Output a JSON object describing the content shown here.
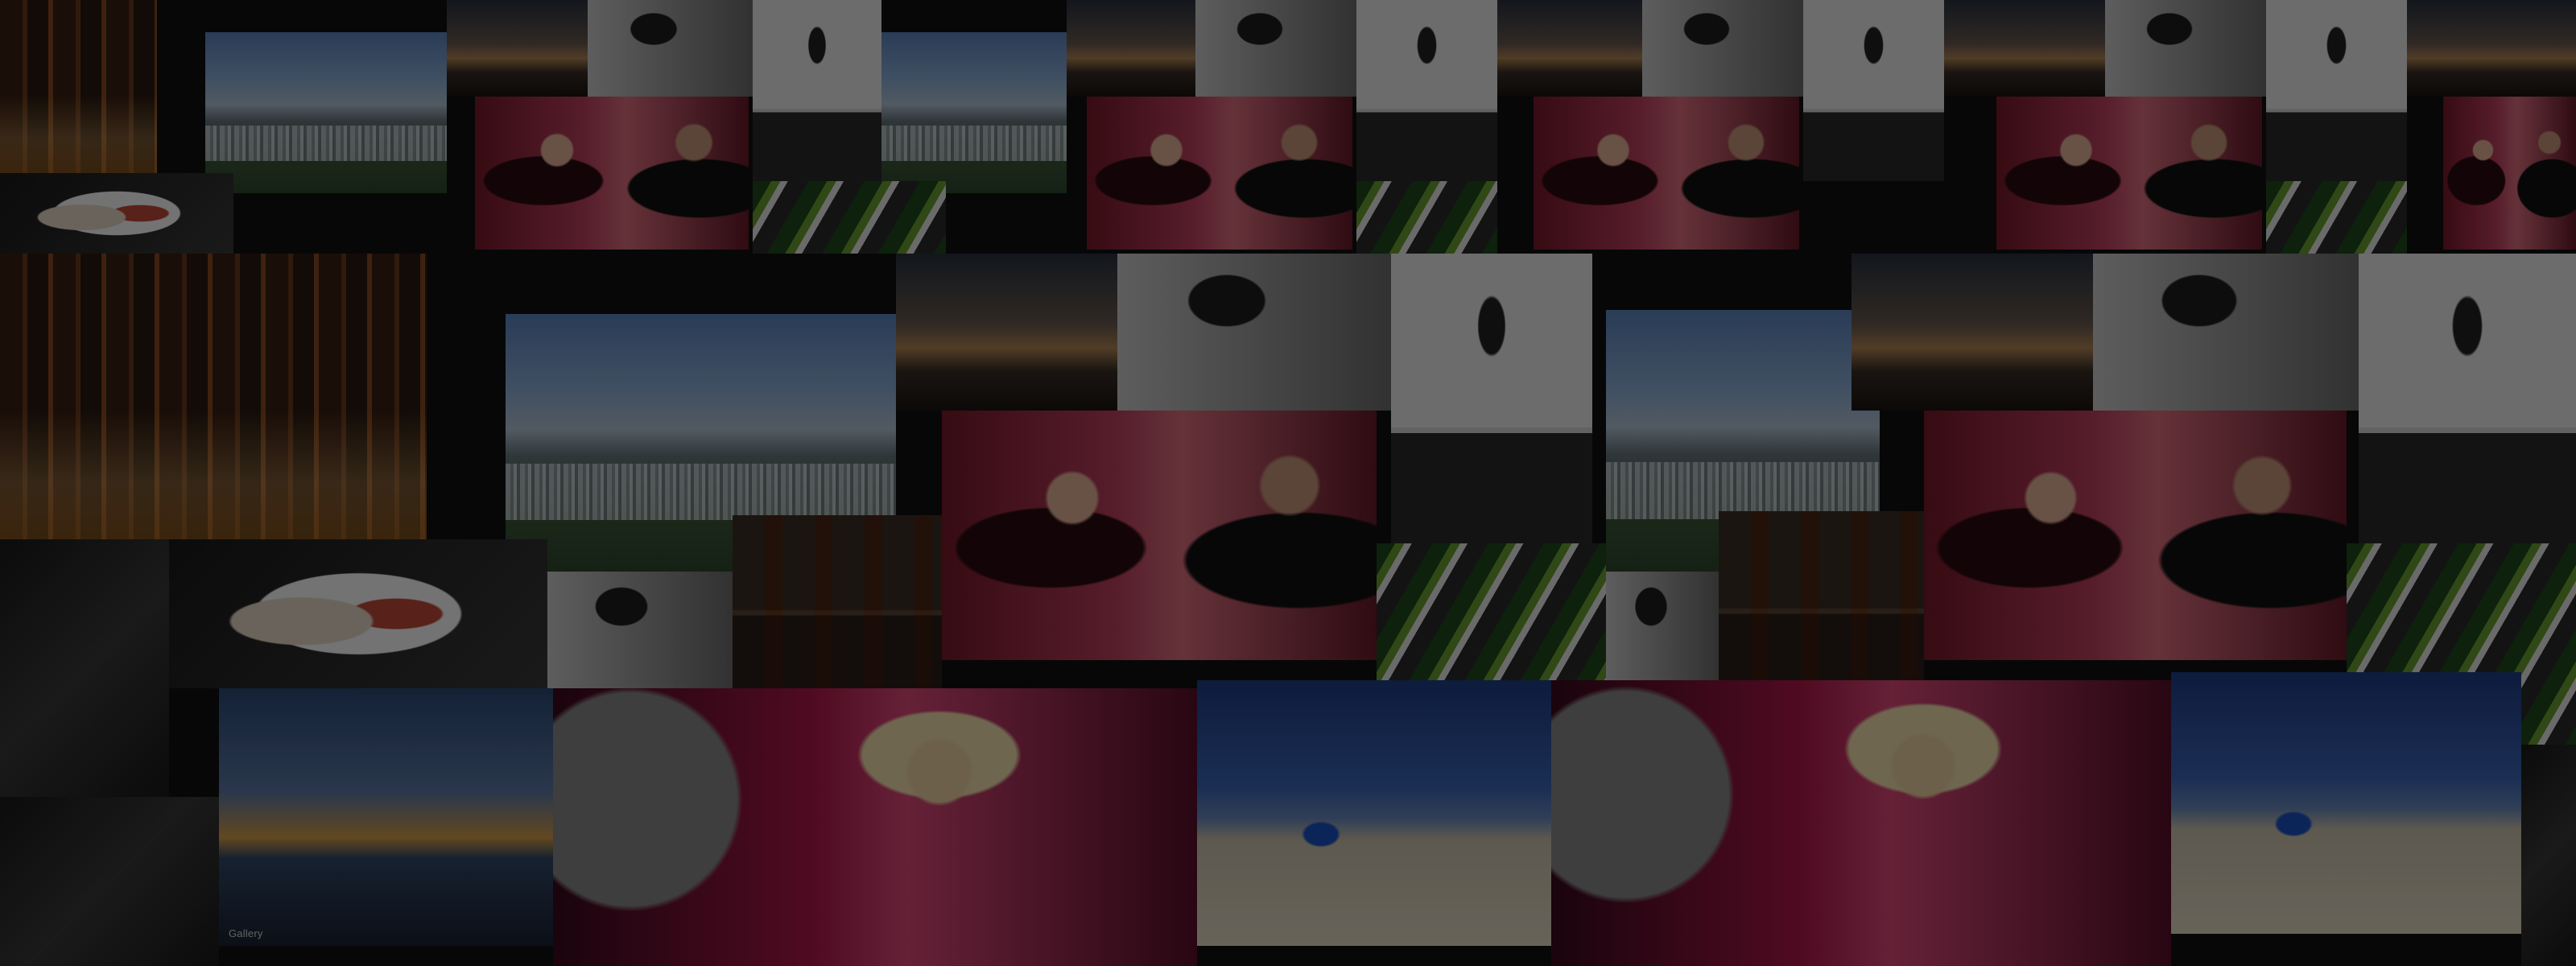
{
  "collage": {
    "tiles": [
      {
        "name": "city-night-small-tile",
        "theme": "city-night"
      },
      {
        "name": "skyline-small-tile",
        "theme": "skyline"
      },
      {
        "name": "sunset-tile",
        "theme": "sunset"
      },
      {
        "name": "boy-wine-tile",
        "theme": "boy"
      },
      {
        "name": "sketch-portrait-tile",
        "theme": "sketch"
      },
      {
        "name": "couple-wine-tile",
        "theme": "couple"
      },
      {
        "name": "food-plate-tile",
        "theme": "food"
      },
      {
        "name": "city-night-large-tile",
        "theme": "city-night"
      },
      {
        "name": "skyline-large-tile",
        "theme": "skyline"
      },
      {
        "name": "couple-wine-large-tile",
        "theme": "couple"
      },
      {
        "name": "gallery-interior-tile",
        "theme": "gallery"
      },
      {
        "name": "shanghai-night-tile",
        "theme": "shanghai"
      },
      {
        "name": "dj-woman-tile",
        "theme": "dj"
      },
      {
        "name": "beach-umbrella-tile",
        "theme": "beach"
      }
    ],
    "captions": {
      "shanghai_caption": "Gallery",
      "beach_caption": ""
    }
  },
  "colors": {
    "background": "#101012",
    "overlay": "rgba(0,0,0,0.55)"
  }
}
